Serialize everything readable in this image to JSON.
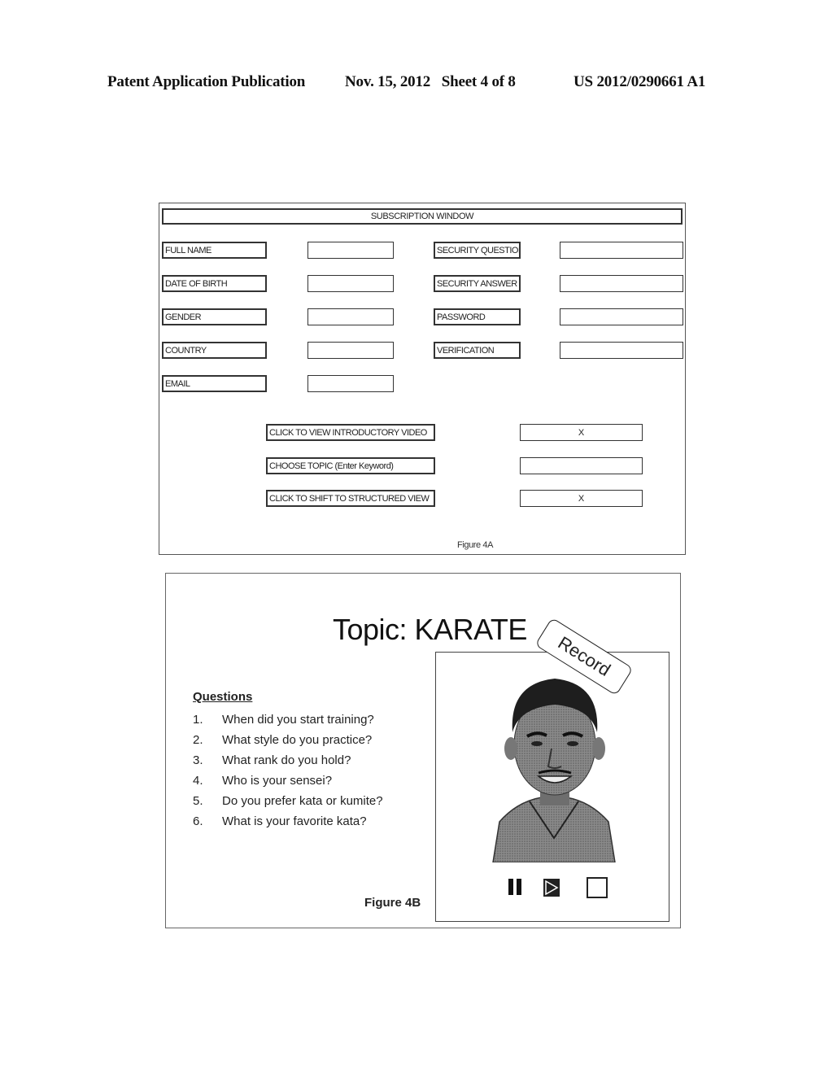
{
  "header": {
    "left": "Patent Application Publication",
    "middle": "Nov. 15, 2012   Sheet 4 of 8",
    "right": "US 2012/0290661 A1"
  },
  "figure_4a": {
    "title": "SUBSCRIPTION WINDOW",
    "left_fields": [
      {
        "label": "FULL NAME",
        "value": ""
      },
      {
        "label": "DATE OF BIRTH",
        "value": ""
      },
      {
        "label": "GENDER",
        "value": ""
      },
      {
        "label": "COUNTRY",
        "value": ""
      },
      {
        "label": "EMAIL",
        "value": ""
      }
    ],
    "right_fields": [
      {
        "label": "SECURITY QUESTION",
        "value": ""
      },
      {
        "label": "SECURITY ANSWER",
        "value": ""
      },
      {
        "label": "PASSWORD",
        "value": ""
      },
      {
        "label": "VERIFICATION",
        "value": ""
      }
    ],
    "actions": [
      {
        "label": "CLICK TO VIEW INTRODUCTORY VIDEO",
        "value": "X"
      },
      {
        "label": "CHOOSE TOPIC (Enter Keyword)",
        "value": ""
      },
      {
        "label": "CLICK TO SHIFT TO STRUCTURED VIEW",
        "value": "X"
      }
    ],
    "caption": "Figure 4A"
  },
  "figure_4b": {
    "topic_title": "Topic: KARATE",
    "record_label": "Record",
    "questions_heading": "Questions",
    "questions": [
      {
        "num": "1.",
        "text": "When did you start training?"
      },
      {
        "num": "2.",
        "text": "What style do you practice?"
      },
      {
        "num": "3.",
        "text": "What rank do you hold?"
      },
      {
        "num": "4.",
        "text": "Who is your sensei?"
      },
      {
        "num": "5.",
        "text": "Do you prefer kata or kumite?"
      },
      {
        "num": "6.",
        "text": "What is your favorite kata?"
      }
    ],
    "controls": {
      "pause": "pause-icon",
      "play": "play-icon",
      "stop": "stop-icon"
    },
    "caption": "Figure 4B"
  }
}
